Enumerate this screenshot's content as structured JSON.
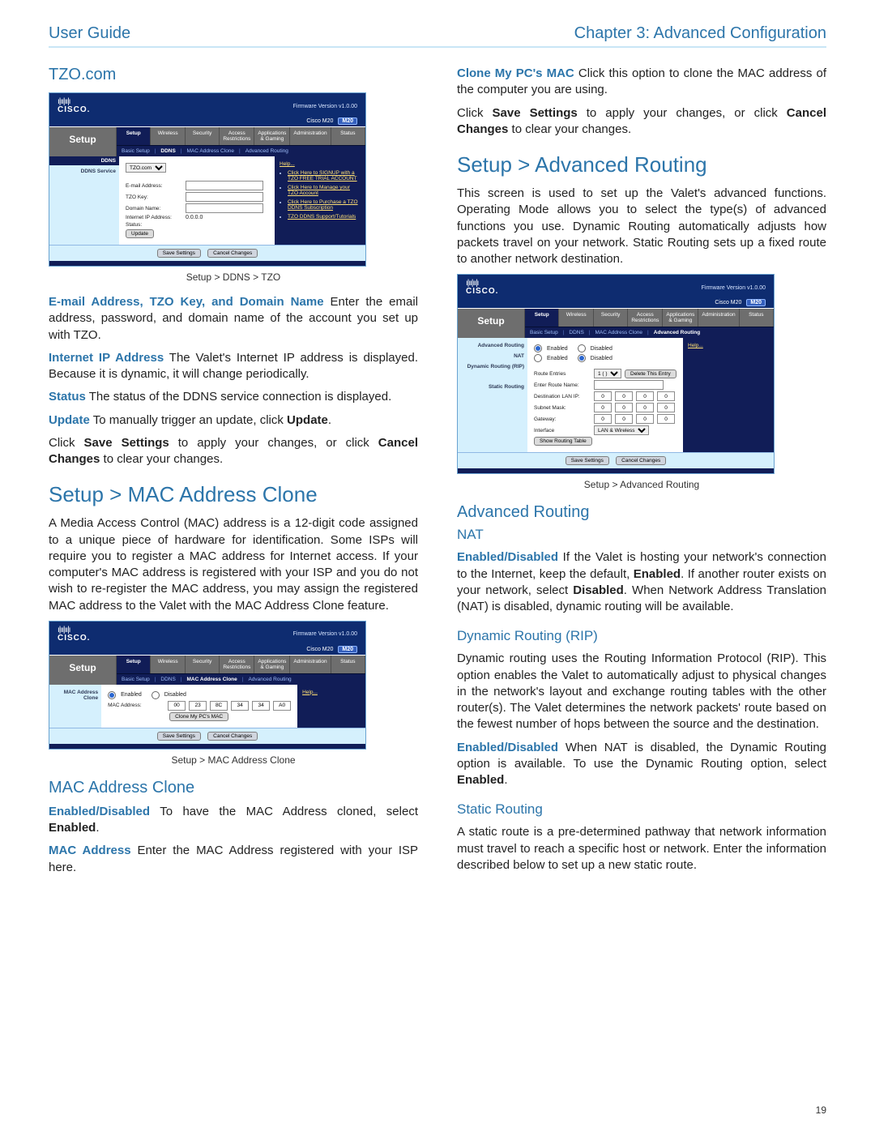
{
  "header": {
    "left": "User Guide",
    "right": "Chapter 3: Advanced Configuration"
  },
  "pageNumber": "19",
  "left": {
    "tzoLabel": "TZO.com",
    "shot1": {
      "fw": "Firmware Version  v1.0.00",
      "model": "Cisco M20",
      "modelBadge": "M20",
      "setup": "Setup",
      "tabs": [
        "Setup",
        "Wireless",
        "Security",
        "Access Restrictions",
        "Applications & Gaming",
        "Administration",
        "Status"
      ],
      "sub": [
        "Basic Setup",
        "DDNS",
        "MAC Address Clone",
        "Advanced Routing"
      ],
      "leftgroup1": "DDNS",
      "leftgroup2": "DDNS Service",
      "ddnsSelect": "TZO.com",
      "fields": {
        "email": "E-mail Address:",
        "tzokey": "TZO Key:",
        "domain": "Domain Name:",
        "ip": "Internet IP Address:",
        "ipval": "0.0.0.0",
        "status": "Status:",
        "updateBtn": "Update"
      },
      "help": "Help...",
      "helpItems": [
        "Click Here to SIGNUP with a TZO FREE TRIAL ACCOUNT",
        "Click Here to Manage your TZO Account",
        "Click Here to Purchase a TZO DDNS Subscription",
        "TZO DDNS Support/Tutorials"
      ],
      "save": "Save Settings",
      "cancel": "Cancel Changes",
      "caption": "Setup > DDNS > TZO"
    },
    "p1a": "E-mail Address, TZO Key, and Domain Name",
    "p1b": " Enter the email address, password, and domain name of the account you set up with TZO.",
    "p2a": "Internet IP Address",
    "p2b": " The Valet's Internet IP address is displayed. Because it is dynamic, it will change periodically.",
    "p3a": "Status",
    "p3b": " The status of the DDNS service connection is displayed.",
    "p4a": "Update",
    "p4b": "  To manually trigger an update, click ",
    "p4c": "Update",
    "p4d": ".",
    "p5": "Click ",
    "p5b": "Save Settings",
    "p5c": " to apply your changes, or click ",
    "p5d": "Cancel Changes",
    "p5e": " to clear your changes.",
    "macHeading": "Setup > MAC Address Clone",
    "macIntro": "A Media Access Control (MAC) address is a 12-digit code assigned to a unique piece of hardware for identification. Some ISPs will require you to register a MAC address for Internet access. If your computer's MAC address is registered with your ISP and you do not wish to re-register the MAC address, you may assign the registered MAC address to the Valet with the MAC Address Clone feature.",
    "shot2": {
      "fw": "Firmware Version  v1.0.00",
      "model": "Cisco M20",
      "modelBadge": "M20",
      "setup": "Setup",
      "tabs": [
        "Setup",
        "Wireless",
        "Security",
        "Access Restrictions",
        "Applications & Gaming",
        "Administration",
        "Status"
      ],
      "sub": [
        "Basic Setup",
        "DDNS",
        "MAC Address Clone",
        "Advanced Routing"
      ],
      "leftgroup": "MAC Address Clone",
      "enabled": "Enabled",
      "disabled": "Disabled",
      "maclabel": "MAC Address:",
      "mac": [
        "00",
        "23",
        "8C",
        "34",
        "34",
        "A0"
      ],
      "cloneBtn": "Clone My PC's MAC",
      "help": "Help...",
      "save": "Save Settings",
      "cancel": "Cancel Changes",
      "caption": "Setup > MAC Address Clone"
    },
    "macSub": "MAC Address Clone",
    "mp1a": "Enabled/Disabled",
    "mp1b": " To have the MAC Address cloned, select ",
    "mp1c": "Enabled",
    "mp1d": ".",
    "mp2a": "MAC Address",
    "mp2b": " Enter the MAC Address registered with your ISP here."
  },
  "right": {
    "p1a": "Clone My PC's MAC",
    "p1b": "  Click this option to clone the MAC address of the computer you are using.",
    "p2": "Click ",
    "p2b": "Save Settings",
    "p2c": " to apply your changes, or click ",
    "p2d": "Cancel Changes",
    "p2e": " to clear your changes.",
    "advHeading": "Setup > Advanced Routing",
    "advIntro": "This screen is used to set up the Valet's advanced functions. Operating Mode allows you to select the type(s) of advanced functions you use. Dynamic Routing automatically adjusts how packets travel on your network. Static Routing sets up a fixed route to another network destination.",
    "shot3": {
      "fw": "Firmware Version  v1.0.00",
      "model": "Cisco M20",
      "modelBadge": "M20",
      "setup": "Setup",
      "tabs": [
        "Setup",
        "Wireless",
        "Security",
        "Access Restrictions",
        "Applications & Gaming",
        "Administration",
        "Status"
      ],
      "sub": [
        "Basic Setup",
        "DDNS",
        "MAC Address Clone",
        "Advanced Routing"
      ],
      "left1": "Advanced Routing",
      "left2": "NAT",
      "left3": "Dynamic Routing (RIP)",
      "left4": "Static Routing",
      "enabled": "Enabled",
      "disabled": "Disabled",
      "routeEntries": "Route Entries",
      "routeSel": "1 ( )",
      "deleteBtn": "Delete This Entry",
      "routeName": "Enter Route Name:",
      "destLan": "Destination LAN IP:",
      "subnet": "Subnet Mask:",
      "gateway": "Gateway:",
      "iface": "Interface",
      "ifaceSel": "LAN & Wireless",
      "showRoute": "Show Routing Table",
      "help": "Help...",
      "save": "Save Settings",
      "cancel": "Cancel Changes",
      "caption": "Setup > Advanced Routing"
    },
    "advSub": "Advanced Routing",
    "natLabel": "NAT",
    "np1a": "Enabled/Disabled",
    "np1b": "  If the Valet is hosting your network's connection to the Internet, keep the default, ",
    "np1c": "Enabled",
    "np1d": ". If another router exists on your network, select ",
    "np1e": "Disabled",
    "np1f": ". When Network Address Translation (NAT) is disabled, dynamic routing will be available.",
    "ripLabel": "Dynamic Routing (RIP)",
    "rp1": "Dynamic routing uses the Routing Information Protocol (RIP). This option enables the Valet to automatically adjust to physical changes in the network's layout and exchange routing tables with the other router(s). The Valet determines the network packets' route based on the fewest number of hops between the source and the destination.",
    "rp2a": "Enabled/Disabled",
    "rp2b": " When NAT is disabled, the Dynamic Routing option is available. To use the Dynamic Routing option, select ",
    "rp2c": "Enabled",
    "rp2d": ".",
    "staticLabel": "Static Routing",
    "sp1": "A static route is a pre-determined pathway that network information must travel to reach a specific host or network. Enter the information described below to set up a new static route."
  }
}
